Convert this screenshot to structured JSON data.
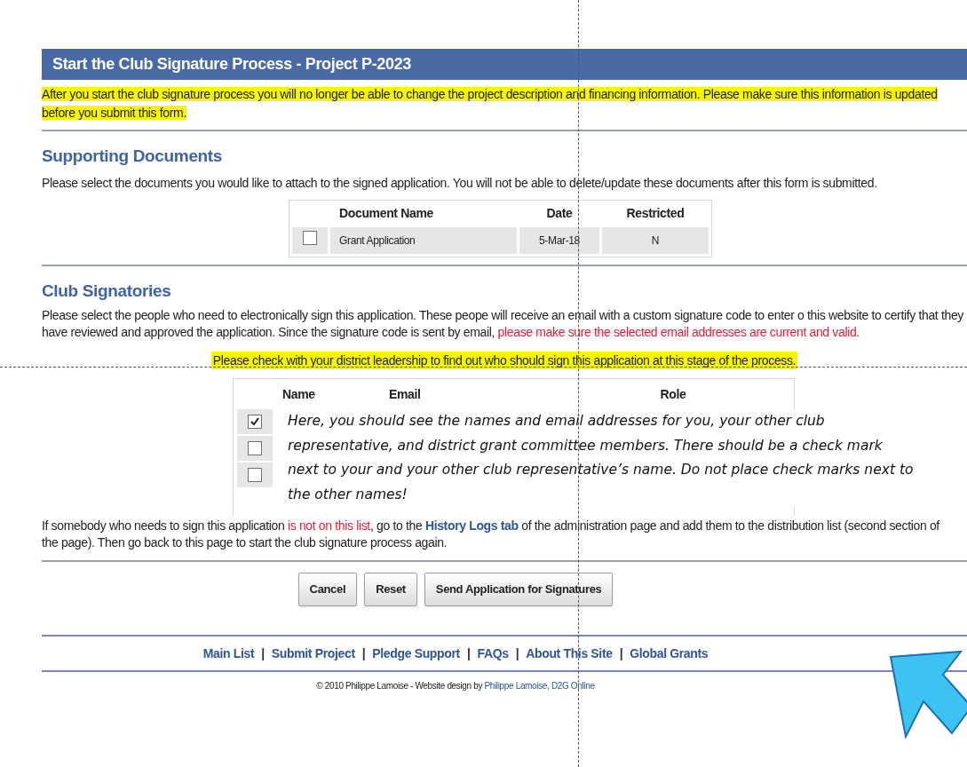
{
  "header": {
    "title": "Start the Club Signature Process - Project P-2023"
  },
  "warning": "After you start the club signature process you will no longer be able to change the project description and financing information. Please make sure this information is updated before you submit this form.",
  "documents": {
    "heading": "Supporting Documents",
    "intro": "Please select the documents you would like to attach to the signed application. You will not be able to delete/update these documents after this form is submitted.",
    "columns": [
      "Document Name",
      "Date",
      "Restricted"
    ],
    "rows": [
      {
        "checked": false,
        "cells": [
          "Grant Application",
          "5-Mar-18",
          "N"
        ]
      }
    ]
  },
  "signatories": {
    "heading": "Club Signatories",
    "intro": [
      {
        "kind": "normal",
        "text": "Please select the people who need to electronically sign this application. These peope will receive an email with a custom signature code to enter o this website to certify that they have reviewed and approved the application. Since the signature code is sent by email, "
      },
      {
        "kind": "alert",
        "text": "please make sure the selected email addresses are current and valid."
      }
    ],
    "notice": "Please check with your district leadership to find out who should sign this application at this stage of the process.",
    "columns": [
      "Name",
      "Email",
      "Role"
    ],
    "rows": [
      {
        "checked": true
      },
      {
        "checked": false
      },
      {
        "checked": false
      }
    ],
    "callout": "Here, you should see the names and email addresses for you, your other club representative, and district grant committee members.  There should be a check mark next to your and your other club representative’s name.  Do not place check marks next to the other names!",
    "footnote": [
      {
        "kind": "normal",
        "text": "If somebody who needs to sign this application "
      },
      {
        "kind": "alert",
        "text": "is not on this list"
      },
      {
        "kind": "normal",
        "text": ", go to the "
      },
      {
        "kind": "link",
        "text": "History Logs tab"
      },
      {
        "kind": "normal",
        "text": " of the administration page and add them to the distribution list (second section of the page). Then go back to this page to start the club signature process again."
      }
    ]
  },
  "buttons": [
    "Cancel",
    "Reset",
    "Send Application for Signatures"
  ],
  "footer": {
    "items": [
      {
        "kind": "link",
        "text": "Main List"
      },
      {
        "kind": "separator",
        "text": "|"
      },
      {
        "kind": "link",
        "text": "Submit Project"
      },
      {
        "kind": "separator",
        "text": "|"
      },
      {
        "kind": "link",
        "text": "Pledge Support"
      },
      {
        "kind": "separator",
        "text": "|"
      },
      {
        "kind": "link",
        "text": "FAQs"
      },
      {
        "kind": "separator",
        "text": "|"
      },
      {
        "kind": "link",
        "text": "About This Site"
      },
      {
        "kind": "separator",
        "text": "|"
      },
      {
        "kind": "link",
        "text": "Global Grants"
      }
    ],
    "copyright": [
      {
        "kind": "normal",
        "text": "© 2010 Philippe Lamoise - Website design by "
      },
      {
        "kind": "link",
        "text": "Philippe Lamoise, D2G Online"
      }
    ]
  }
}
